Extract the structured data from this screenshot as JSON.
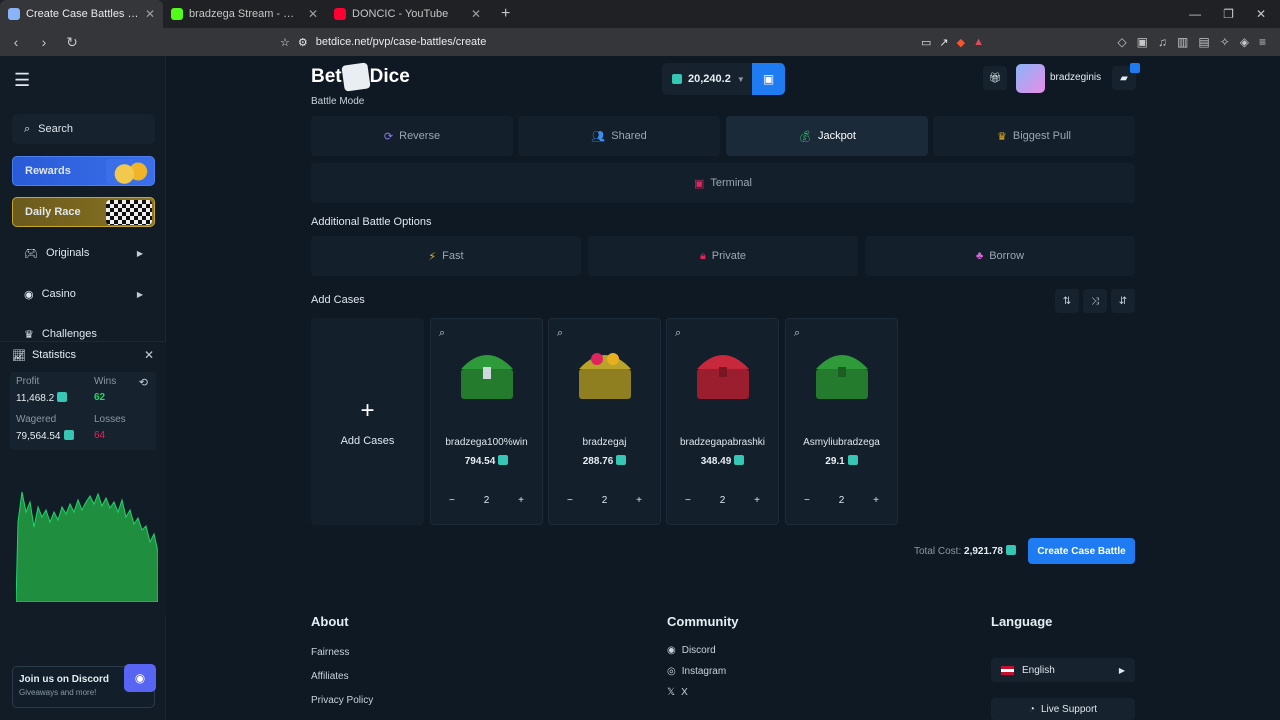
{
  "browser": {
    "tabs": [
      {
        "title": "Create Case Battles on BetDice",
        "active": true,
        "color": "#8ab4f8"
      },
      {
        "title": "bradzega Stream - Watch Live on Kick",
        "active": false,
        "color": "#53fc18"
      },
      {
        "title": "DONCIC - YouTube",
        "active": false,
        "color": "#ff0033"
      }
    ],
    "url": "betdice.net/pvp/case-battles/create"
  },
  "sidebar": {
    "search_label": "Search",
    "rewards_label": "Rewards",
    "daily_race_label": "Daily Race",
    "originals_label": "Originals",
    "casino_label": "Casino",
    "challenges_label": "Challenges"
  },
  "statistics": {
    "title": "Statistics",
    "profit_label": "Profit",
    "profit_value": "11,468.2",
    "wins_label": "Wins",
    "wins_value": "62",
    "wagered_label": "Wagered",
    "wagered_value": "79,564.54",
    "losses_label": "Losses",
    "losses_value": "64",
    "line_color": "#22d36b"
  },
  "discord": {
    "title": "Join us on Discord",
    "subtitle": "Giveaways and more!"
  },
  "header": {
    "logo_left": "Bet",
    "logo_right": "Dice",
    "balance": "20,240.2",
    "username": "bradzeginis"
  },
  "battle_mode": {
    "label": "Battle Mode",
    "modes": [
      {
        "label": "Reverse",
        "icon": "reverse-icon"
      },
      {
        "label": "Shared",
        "icon": "shared-icon"
      },
      {
        "label": "Jackpot",
        "icon": "jackpot-icon",
        "active": true
      },
      {
        "label": "Biggest Pull",
        "icon": "crown-icon"
      },
      {
        "label": "Terminal",
        "icon": "terminal-icon"
      }
    ]
  },
  "additional": {
    "label": "Additional Battle Options",
    "options": [
      {
        "label": "Fast",
        "icon": "lightning-icon"
      },
      {
        "label": "Private",
        "icon": "lock-icon"
      },
      {
        "label": "Borrow",
        "icon": "borrow-icon"
      }
    ]
  },
  "cases_section": {
    "label": "Add Cases",
    "add_label": "Add Cases",
    "cases": [
      {
        "name": "bradzega100%win",
        "price": "794.54",
        "qty": "2",
        "color": "#2f9a3a"
      },
      {
        "name": "bradzegaj",
        "price": "288.76",
        "qty": "2",
        "color": "#b8a42a"
      },
      {
        "name": "bradzegapabrashki",
        "price": "348.49",
        "qty": "2",
        "color": "#c8283c"
      },
      {
        "name": "Asmyliubradzega",
        "price": "29.1",
        "qty": "2",
        "color": "#2f9a3a"
      }
    ]
  },
  "total": {
    "label": "Total Cost:",
    "value": "2,921.78"
  },
  "create_button": "Create Case Battle",
  "footer": {
    "about_title": "About",
    "about_links": [
      "Fairness",
      "Affiliates",
      "Privacy Policy"
    ],
    "community_title": "Community",
    "community_links": [
      "Discord",
      "Instagram",
      "X"
    ],
    "language_title": "Language",
    "language_value": "English",
    "support_label": "Live Support"
  }
}
